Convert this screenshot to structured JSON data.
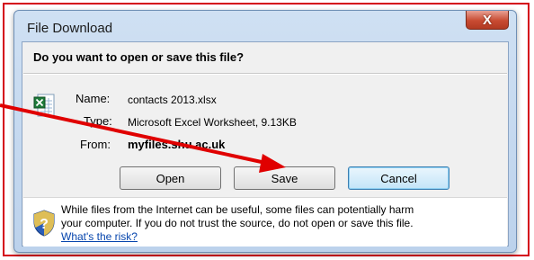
{
  "window": {
    "title": "File Download",
    "close_glyph": "X"
  },
  "dialog": {
    "question": "Do you want to open or save this file?",
    "name_label": "Name:",
    "name_value": "contacts 2013.xlsx",
    "type_label": "Type:",
    "type_value": "Microsoft Excel Worksheet, 9.13KB",
    "from_label": "From:",
    "from_value": "myfiles.shu.ac.uk"
  },
  "buttons": {
    "open": "Open",
    "save": "Save",
    "cancel": "Cancel"
  },
  "info": {
    "warning_line1": "While files from the Internet can be useful, some files can potentially harm",
    "warning_line2": "your computer. If you do not trust the source, do not open or save this file.",
    "risk_link": "What's the risk?"
  },
  "icons": {
    "file_icon": "excel-file-icon",
    "info_icon": "security-shield-icon",
    "annotation": "red-arrow"
  },
  "colors": {
    "annotation_red": "#e00000",
    "frame_border": "#d4001a",
    "link_blue": "#0645ad",
    "close_button": "#c84b32"
  }
}
